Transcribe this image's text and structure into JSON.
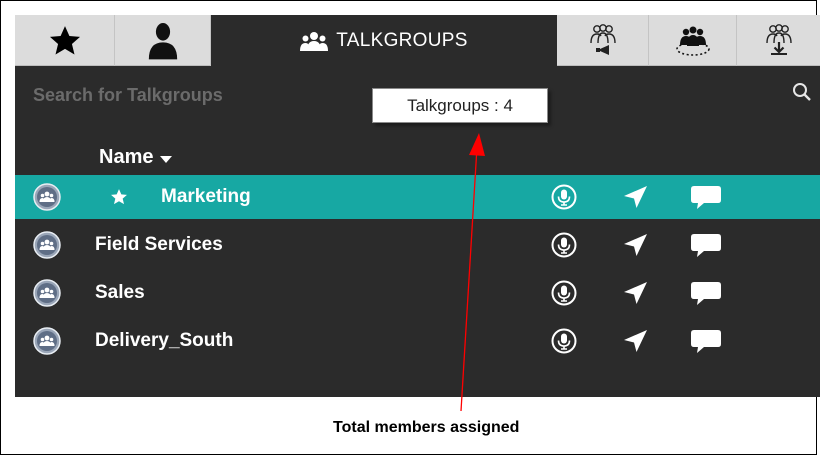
{
  "tabs": [
    {
      "name": "favorites",
      "icon": "star-icon"
    },
    {
      "name": "contacts",
      "icon": "person-icon"
    },
    {
      "name": "talkgroups",
      "icon": "group-icon",
      "label": "TALKGROUPS",
      "active": true
    },
    {
      "name": "broadcast",
      "icon": "group-broadcast-icon"
    },
    {
      "name": "group-call",
      "icon": "group-circle-icon"
    },
    {
      "name": "group-download",
      "icon": "group-download-icon"
    }
  ],
  "search": {
    "placeholder": "Search for Talkgroups",
    "icon": "search-icon"
  },
  "tooltip": {
    "text": "Talkgroups : 4"
  },
  "list": {
    "header": "Name",
    "rows": [
      {
        "name": "Marketing",
        "favorite": true,
        "selected": true
      },
      {
        "name": "Field Services",
        "favorite": false,
        "selected": false
      },
      {
        "name": "Sales",
        "favorite": false,
        "selected": false
      },
      {
        "name": "Delivery_South",
        "favorite": false,
        "selected": false
      }
    ]
  },
  "annotation": {
    "caption": "Total members assigned"
  },
  "colors": {
    "background": "#2b2b2b",
    "tabbar": "#dcdcdc",
    "selected_row": "#17a8a3",
    "annotation_arrow": "#ff0000"
  }
}
